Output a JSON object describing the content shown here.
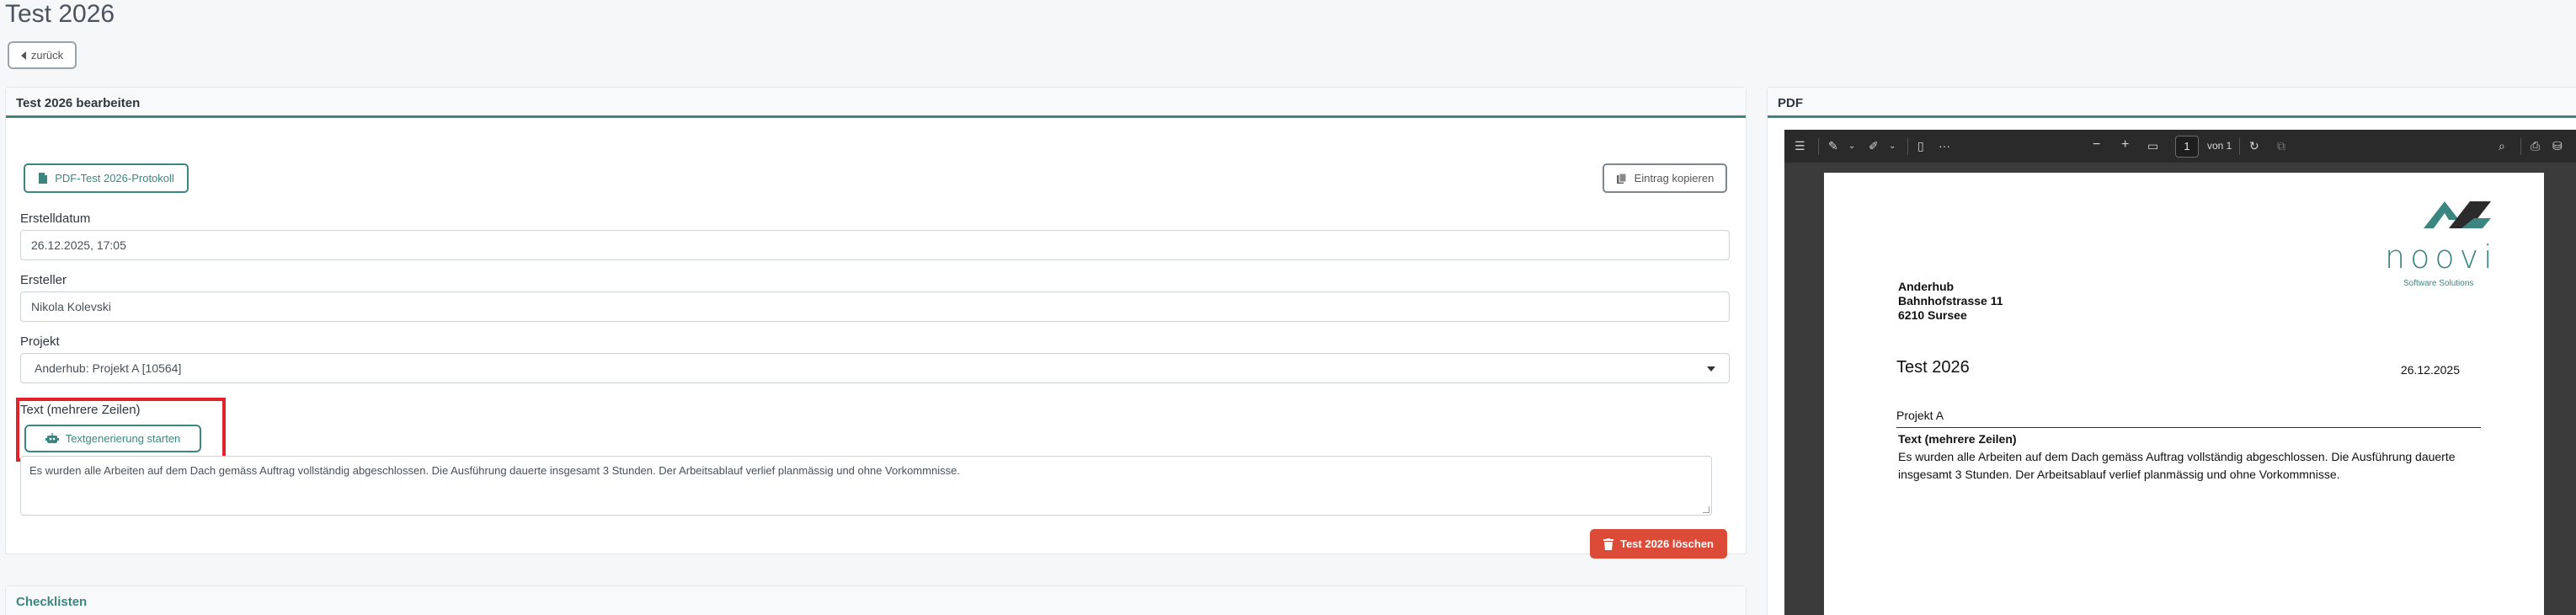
{
  "page": {
    "title": "Test 2026",
    "back_label": "zurück"
  },
  "edit_card": {
    "header": "Test 2026 bearbeiten",
    "pdf_button": "PDF-Test 2026-Protokoll",
    "copy_button": "Eintrag kopieren",
    "fields": {
      "created_label": "Erstelldatum",
      "created_value": "26.12.2025, 17:05",
      "creator_label": "Ersteller",
      "creator_value": "Nikola Kolevski",
      "project_label": "Projekt",
      "project_value": "Anderhub: Projekt A [10564]",
      "text_label": "Text (mehrere Zeilen)",
      "ai_button": "Textgenerierung starten",
      "text_value": "Es wurden alle Arbeiten auf dem Dach gemäss Auftrag vollständig abgeschlossen. Die Ausführung dauerte insgesamt 3 Stunden. Der Arbeitsablauf verlief planmässig und ohne Vorkommnisse."
    },
    "delete_button": "Test 2026 löschen"
  },
  "checklists_card": {
    "header": "Checklisten"
  },
  "pdf_card": {
    "header": "PDF",
    "toolbar": {
      "page_number": "1",
      "page_of": "von 1"
    },
    "document": {
      "logo_text": "noovi",
      "logo_sub": "Software Solutions",
      "address_line1": "Anderhub",
      "address_line2": "Bahnhofstrasse 11",
      "address_line3": "6210 Sursee",
      "title": "Test 2026",
      "date": "26.12.2025",
      "project": "Projekt A",
      "section_label": "Text (mehrere Zeilen)",
      "section_text": "Es wurden alle Arbeiten auf dem Dach gemäss Auftrag vollständig abgeschlossen. Die Ausführung dauerte insgesamt 3 Stunden. Der Arbeitsablauf verlief planmässig und ohne Vorkommnisse."
    }
  },
  "colors": {
    "accent": "#3c8682",
    "danger": "#dc4a38",
    "highlight": "#e2232a"
  }
}
